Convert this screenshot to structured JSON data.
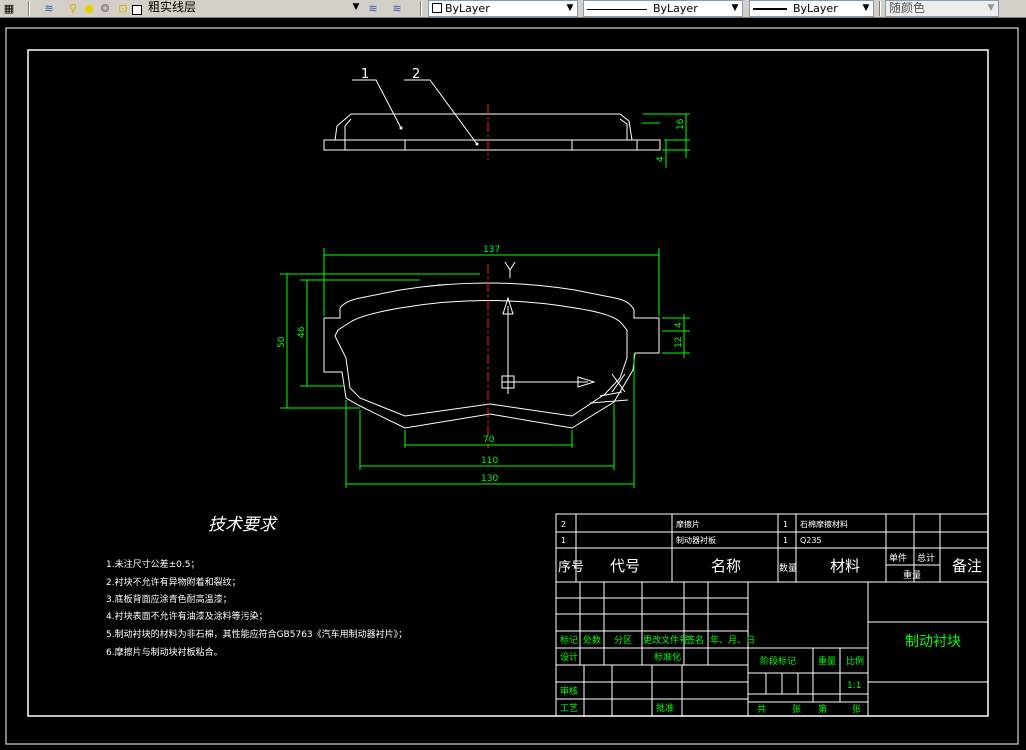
{
  "toolbar": {
    "layer_name": "粗实线层",
    "color_value": "ByLayer",
    "linetype_value": "ByLayer",
    "lineweight_value": "ByLayer",
    "plotstyle_value": "随颜色"
  },
  "drawing": {
    "balloons": [
      "1",
      "2"
    ],
    "dims": {
      "top_16": "16",
      "top_4": "4",
      "w137": "137",
      "h50": "50",
      "h46": "46",
      "r4": "4",
      "r12": "12",
      "b70": "70",
      "b110": "110",
      "b130": "130"
    },
    "tech_title": "技术要求",
    "tech_notes": [
      "1.未注尺寸公差±0.5；",
      "2.衬块不允许有异物附着和裂纹；",
      "3.底板背面应涂青色耐高温漆；",
      "4.衬块表面不允许有油漆及涂料等污染；",
      "5.制动衬块的材料为非石棉，其性能应符合GB5763《汽车用制动器衬片》；",
      "6.摩擦片与制动块衬板粘合。"
    ],
    "bom": {
      "rows": [
        {
          "no": "2",
          "name": "摩擦片",
          "qty": "1",
          "material": "石棉摩擦材料"
        },
        {
          "no": "1",
          "name": "制动器衬板",
          "qty": "1",
          "material": "Q235"
        }
      ],
      "header": {
        "no": "序号",
        "code": "代号",
        "name": "名称",
        "qty": "数量",
        "material": "材料",
        "single": "单件",
        "total": "总计",
        "weight": "重量",
        "remark": "备注"
      }
    },
    "title_block": {
      "mark": "标记",
      "count": "处数",
      "zone": "分区",
      "doc_no": "更改文件号",
      "signature": "签名",
      "date": "年、月、日",
      "design": "设计",
      "standard": "标准化",
      "check": "审核",
      "process": "工艺",
      "approve": "批准",
      "stage": "阶段标记",
      "weight": "重量",
      "scale": "比例",
      "scale_value": "1:1",
      "total_sheets": "共",
      "sheets": "张",
      "sheet_no": "第",
      "sheet": "张",
      "drawing_name": "制动衬块"
    }
  }
}
